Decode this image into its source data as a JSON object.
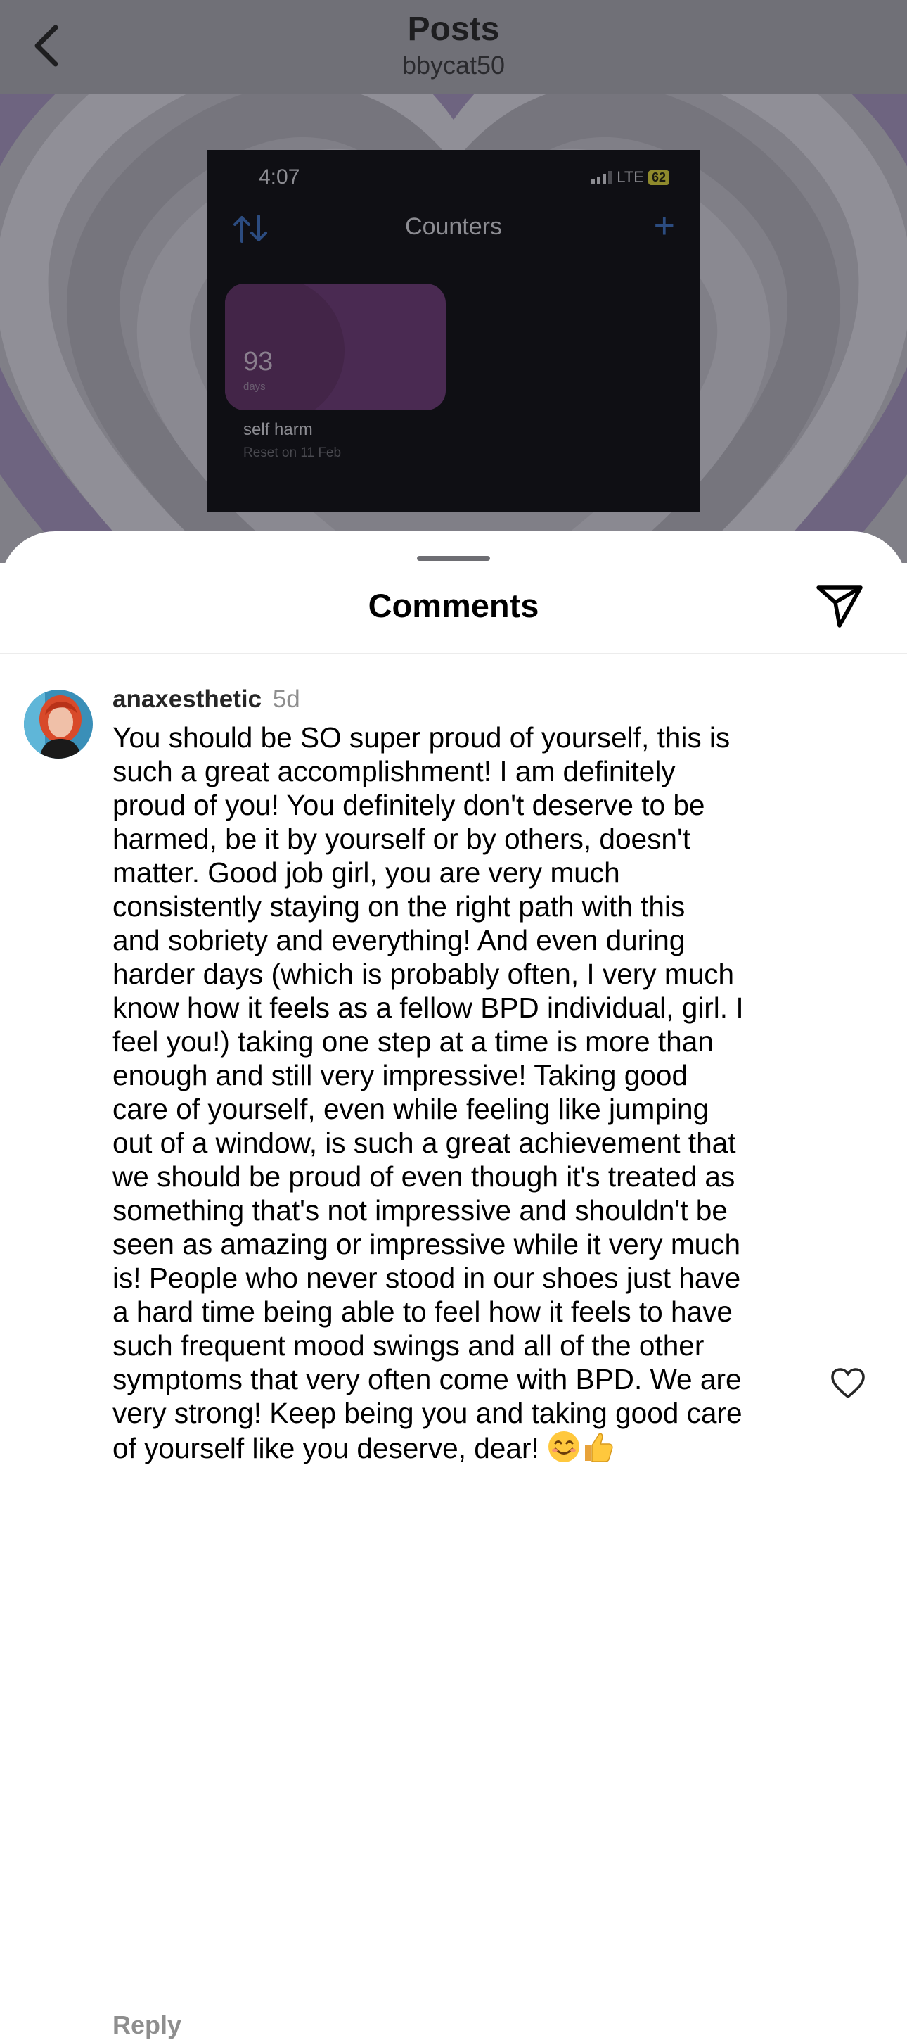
{
  "header": {
    "title": "Posts",
    "username": "bbycat50"
  },
  "post_image": {
    "time": "4:07",
    "network": "LTE",
    "battery": "62",
    "screen_title": "Counters",
    "counter": {
      "value": "93",
      "unit": "days",
      "label": "self harm",
      "reset_note": "Reset on 11 Feb"
    }
  },
  "comments_sheet": {
    "title": "Comments",
    "comments": [
      {
        "username": "anaxesthetic",
        "time_ago": "5d",
        "text": "You should be SO super proud of yourself, this is\nsuch a great accomplishment! I am definitely\nproud of you! You definitely don't deserve to be\nharmed, be it by yourself or by others, doesn't\nmatter. Good job girl, you are very much\nconsistently staying on the right path with this\nand sobriety and everything! And even during\nharder days (which is probably often, I very much\nknow how it feels as a fellow BPD individual, girl. I\nfeel you!) taking one step at a time is more than\nenough and still very impressive! Taking good\ncare of yourself, even while feeling like jumping\nout of a window, is such a great achievement that\nwe should be proud of even though it's treated as\nsomething that's not impressive and shouldn't be\nseen as amazing or impressive while it very much\nis! People who never stood in our shoes just have\na hard time being able to feel how it feels to have\nsuch frequent mood swings and all of the other\nsymptoms that very often come with BPD. We are\nvery strong! Keep being you and taking good care\nof yourself like you deserve, dear!",
        "emojis": [
          "smiling-face",
          "thumbs-up"
        ],
        "reply_label": "Reply"
      }
    ]
  },
  "colors": {
    "sheet_background": "#ffffff",
    "username_text": "#262626",
    "secondary_text": "#8e8e8e",
    "dim_overlay": "#7b7a82"
  }
}
